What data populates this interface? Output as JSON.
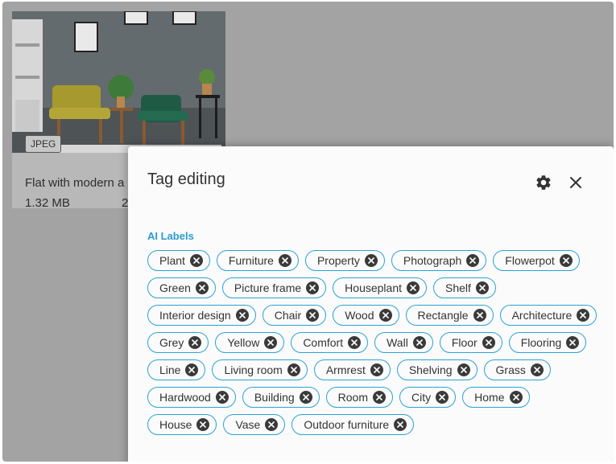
{
  "card": {
    "file_type": "JPEG",
    "title": "Flat with modern a",
    "size": "1.32 MB",
    "date_fragment": "2"
  },
  "modal": {
    "title": "Tag editing",
    "settings_icon": "gear-icon",
    "close_icon": "close-icon"
  },
  "ai_labels": {
    "heading": "AI Labels",
    "tags": [
      "Plant",
      "Furniture",
      "Property",
      "Photograph",
      "Flowerpot",
      "Green",
      "Picture frame",
      "Houseplant",
      "Shelf",
      "Interior design",
      "Chair",
      "Wood",
      "Rectangle",
      "Architecture",
      "Grey",
      "Yellow",
      "Comfort",
      "Wall",
      "Floor",
      "Flooring",
      "Line",
      "Living room",
      "Armrest",
      "Shelving",
      "Grass",
      "Hardwood",
      "Building",
      "Room",
      "City",
      "Home",
      "House",
      "Vase",
      "Outdoor furniture"
    ]
  },
  "colors": {
    "accent": "#2aa3d6",
    "overlay": "#a3a3a3",
    "modal_bg": "#fbfbfb"
  }
}
